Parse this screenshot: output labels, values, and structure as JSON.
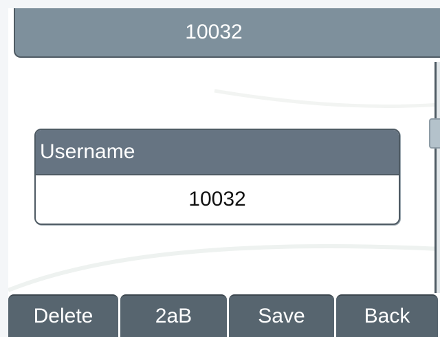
{
  "title_bar": {
    "title": "10032"
  },
  "field": {
    "label": "Username",
    "value": "10032"
  },
  "softkeys": [
    {
      "label": "Delete"
    },
    {
      "label": "2aB"
    },
    {
      "label": "Save"
    },
    {
      "label": "Back"
    }
  ],
  "colors": {
    "title_bg": "#7e909c",
    "label_bg": "#667482",
    "softkey_bg": "#57656f",
    "border": "#4e5a63"
  }
}
